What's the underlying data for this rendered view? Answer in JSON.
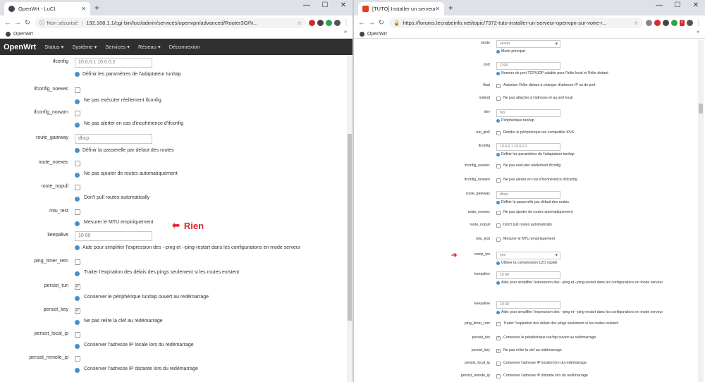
{
  "colors": {
    "annotation": "#e3242b",
    "help_icon": "#4a90c8",
    "header_bg": "#2f2f2f"
  },
  "left": {
    "tab_title": "OpenWrt - LuCI",
    "security": "Non sécurisé",
    "url": "192.168.1.1/cgi-bin/luci/admin/services/openvpn/advanced/Router3G/N...",
    "bookmark": "OpenWrt",
    "brand": "OpenWrt",
    "menu": [
      "Status ▾",
      "Système ▾",
      "Services ▾",
      "Réseau ▾",
      "Déconnexion"
    ],
    "annotation": "Rien",
    "fields": [
      {
        "label": "ifconfig",
        "value": "10.0.0.1 10.0.0.2",
        "help": "Définir les paramètres de l'adaptateur tun/tap"
      },
      {
        "label": "ifconfig_noexec",
        "checked": false,
        "text": "Ne pas exécuter réellement ifconfig"
      },
      {
        "label": "ifconfig_nowarn",
        "checked": false,
        "text": "Ne pas alerter en cas d'incohérence d'ifconfig"
      },
      {
        "label": "route_gateway",
        "value": "dhcp",
        "help": "Définir la passerelle par défaut des routes"
      },
      {
        "label": "route_noexec",
        "checked": false,
        "text": "Ne pas ajouter de routes automatiquement"
      },
      {
        "label": "route_nopull",
        "checked": false,
        "text": "Don't pull routes automatically"
      },
      {
        "label": "mtu_test",
        "checked": false,
        "text": "Mesurer le MTU empiriquement"
      },
      {
        "label": "keepalive",
        "value": "10 60",
        "help": "Aide pour simplifier l'expression des --ping et --ping-restart dans les configurations en mode serveur"
      },
      {
        "label": "ping_timer_rem",
        "checked": false,
        "text": "Traiter l'expiration des délais des pings seulement si les routes existent"
      },
      {
        "label": "persist_tun",
        "checked": true,
        "text": "Conserver le périphérique tun/tap ouvert au redémarrage"
      },
      {
        "label": "persist_key",
        "checked": true,
        "text": "Ne pas relire la clef au redémarrage"
      },
      {
        "label": "persist_local_ip",
        "checked": false,
        "text": "Conserver l'adresse IP locale lors du redémarrage"
      },
      {
        "label": "persist_remote_ip",
        "checked": false,
        "text": "Conserver l'adresse IP distante lors du redémarrage"
      }
    ]
  },
  "right": {
    "tab_title": "[TUTO] Installer un serveur Open",
    "url": "https://forums.lecrabeinfo.net/topic/7372-tuto-installer-un-serveur-openvpn-sur-votre-r...",
    "bookmark": "OpenWrt",
    "ext_badge": "2",
    "fields": [
      {
        "label": "mode",
        "value": "server",
        "help": "Mode principal"
      },
      {
        "label": "port",
        "value": "1194",
        "help": "Numéro de port TCP/UDP valable pour l'hôte local et l'hôte distant"
      },
      {
        "label": "float",
        "checked": false,
        "text": "Autoriser l'hôte distant à changer d'adresse IP ou de port"
      },
      {
        "label": "nobind",
        "checked": false,
        "text": "Ne pas attacher à l'adresse et au port local"
      },
      {
        "label": "dev",
        "value": "tun",
        "help": "Périphérique tun/tap"
      },
      {
        "label": "tun_ipv6",
        "checked": false,
        "text": "Rendre le périphérique tun compatible IPv6"
      },
      {
        "label": "ifconfig",
        "value": "10.0.0.1 10.0.0.2",
        "help": "Définir les paramètres de l'adaptateur tun/tap"
      },
      {
        "label": "ifconfig_noexec",
        "checked": false,
        "text": "Ne pas exécuter réellement ifconfig"
      },
      {
        "label": "ifconfig_nowarn",
        "checked": false,
        "text": "Ne pas alerter en cas d'incohérence d'ifconfig"
      },
      {
        "label": "route_gateway",
        "value": "dhcp",
        "help": "Définir la passerelle par défaut des routes"
      },
      {
        "label": "route_noexec",
        "checked": false,
        "text": "Ne pas ajouter de routes automatiquement"
      },
      {
        "label": "route_nopull",
        "checked": false,
        "text": "Don't pull routes automatically"
      },
      {
        "label": "mtu_test",
        "checked": false,
        "text": "Mesurer le MTU empiriquement"
      },
      {
        "label": "comp_lzo",
        "value": "yes",
        "help": "Utiliser la compression LZO rapide"
      },
      {
        "label": "keepalive",
        "value": "10 60",
        "help": "Aide pour simplifier l'expression des --ping et --ping-restart dans les configurations en mode serveur"
      },
      {
        "label": "keepalive",
        "value": "10 60",
        "help": "Aide pour simplifier l'expression des --ping et --ping-restart dans les configurations en mode serveur"
      },
      {
        "label": "ping_timer_rem",
        "checked": false,
        "text": "Traiter l'expiration des délais des pings seulement si les routes existent"
      },
      {
        "label": "persist_tun",
        "checked": true,
        "text": "Conserver le périphérique tun/tap ouvert au redémarrage"
      },
      {
        "label": "persist_key",
        "checked": true,
        "text": "Ne pas relire la clef au redémarrage"
      },
      {
        "label": "persist_local_ip",
        "checked": false,
        "text": "Conserver l'adresse IP locales lors du redémarrage"
      },
      {
        "label": "persist_remote_ip",
        "checked": false,
        "text": "Conserver l'adresse IP distante lors du redémarrage"
      }
    ]
  }
}
